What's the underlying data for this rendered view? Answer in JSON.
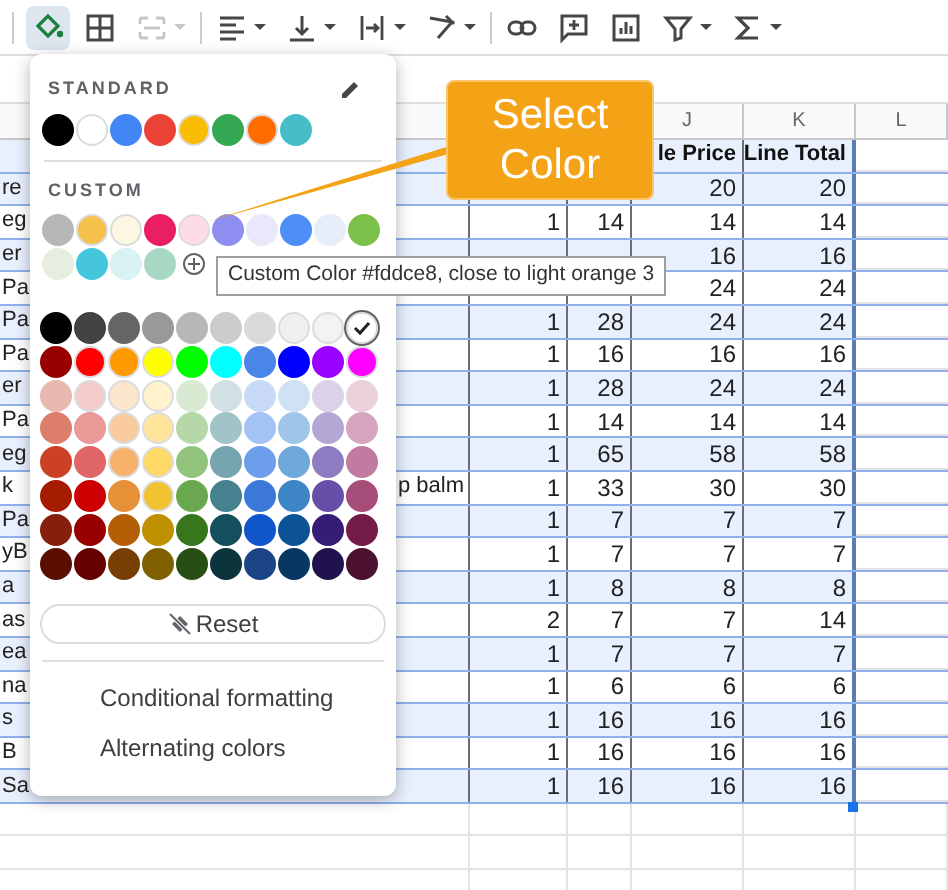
{
  "toolbar": [
    {
      "kind": "fill",
      "active": true,
      "disabled": false,
      "dropdown": false
    },
    {
      "kind": "borders",
      "active": false,
      "disabled": false,
      "dropdown": false
    },
    {
      "kind": "merge",
      "active": false,
      "disabled": true,
      "dropdown": true
    },
    {
      "kind": "align",
      "active": false,
      "disabled": false,
      "dropdown": true
    },
    {
      "kind": "valign",
      "active": false,
      "disabled": false,
      "dropdown": true
    },
    {
      "kind": "wrap",
      "active": false,
      "disabled": false,
      "dropdown": true
    },
    {
      "kind": "rotate",
      "active": false,
      "disabled": false,
      "dropdown": true
    },
    {
      "kind": "link",
      "active": false,
      "disabled": false,
      "dropdown": false
    },
    {
      "kind": "comment",
      "active": false,
      "disabled": false,
      "dropdown": false
    },
    {
      "kind": "chart",
      "active": false,
      "disabled": false,
      "dropdown": false
    },
    {
      "kind": "filter",
      "active": false,
      "disabled": false,
      "dropdown": true
    },
    {
      "kind": "functions",
      "active": false,
      "disabled": false,
      "dropdown": true
    }
  ],
  "sheet": {
    "column_headers": [
      "J",
      "K",
      "L"
    ],
    "header_row": {
      "sale": "le Price",
      "total": "Line Total"
    },
    "rows": [
      {
        "left": "re",
        "sale": "20",
        "total": "20"
      },
      {
        "left": "eg",
        "qty": "1",
        "price": "14",
        "sale": "14",
        "total": "14"
      },
      {
        "left": "er",
        "sale": "16",
        "total": "16"
      },
      {
        "left": "Pa",
        "sale": "24",
        "total": "24"
      },
      {
        "left": "Pa",
        "qty": "1",
        "price": "28",
        "sale": "24",
        "total": "24"
      },
      {
        "left": "Pa",
        "qty": "1",
        "price": "16",
        "sale": "16",
        "total": "16"
      },
      {
        "left": "er",
        "qty": "1",
        "price": "28",
        "sale": "24",
        "total": "24"
      },
      {
        "left": "Pa",
        "qty": "1",
        "price": "14",
        "sale": "14",
        "total": "14"
      },
      {
        "left": "eg",
        "qty": "1",
        "price": "65",
        "sale": "58",
        "total": "58"
      },
      {
        "left": "k",
        "desc": "p balm",
        "qty": "1",
        "price": "33",
        "sale": "30",
        "total": "30"
      },
      {
        "left": "Pa",
        "qty": "1",
        "price": "7",
        "sale": "7",
        "total": "7"
      },
      {
        "left": "yB",
        "qty": "1",
        "price": "7",
        "sale": "7",
        "total": "7"
      },
      {
        "left": "a",
        "qty": "1",
        "price": "8",
        "sale": "8",
        "total": "8"
      },
      {
        "left": "as",
        "qty": "2",
        "price": "7",
        "sale": "7",
        "total": "14"
      },
      {
        "left": "ea",
        "qty": "1",
        "price": "7",
        "sale": "7",
        "total": "7"
      },
      {
        "left": "na",
        "qty": "1",
        "price": "6",
        "sale": "6",
        "total": "6"
      },
      {
        "left": "s",
        "qty": "1",
        "price": "16",
        "sale": "16",
        "total": "16"
      },
      {
        "left": "B",
        "qty": "1",
        "price": "16",
        "sale": "16",
        "total": "16"
      },
      {
        "left": "Sa",
        "qty": "1",
        "price": "16",
        "sale": "16",
        "total": "16"
      }
    ]
  },
  "color_menu": {
    "standard_label": "STANDARD",
    "standard": [
      {
        "color": "#000000"
      },
      {
        "color": "#ffffff"
      },
      {
        "color": "#4285f4"
      },
      {
        "color": "#ea4335"
      },
      {
        "color": "#fbbc04"
      },
      {
        "color": "#34a853"
      },
      {
        "color": "#ff6d01"
      },
      {
        "color": "#46bdc6"
      }
    ],
    "custom_label": "CUSTOM",
    "custom": [
      {
        "color": "#b7b7b7"
      },
      {
        "color": "#f6c14b"
      },
      {
        "color": "#fdf6e3"
      },
      {
        "color": "#e91e63"
      },
      {
        "color": "#fddce8"
      },
      {
        "color": "#8e8ef0"
      },
      {
        "color": "#e8e8fa"
      },
      {
        "color": "#4f8ef7"
      },
      {
        "color": "#e8eef9"
      },
      {
        "color": "#7cc14a"
      },
      {
        "color": "#e6eedf"
      },
      {
        "color": "#46c6dc"
      },
      {
        "color": "#d9f2f4"
      },
      {
        "color": "#a9d8c4"
      }
    ],
    "palette": [
      [
        {
          "color": "#000000",
          "selected": false
        },
        {
          "color": "#434343",
          "selected": false
        },
        {
          "color": "#666666",
          "selected": false
        },
        {
          "color": "#999999",
          "selected": false
        },
        {
          "color": "#b7b7b7",
          "selected": false
        },
        {
          "color": "#cccccc",
          "selected": false
        },
        {
          "color": "#d9d9d9",
          "selected": false
        },
        {
          "color": "#efefef",
          "selected": false
        },
        {
          "color": "#f3f3f3",
          "selected": false
        },
        {
          "color": "#ffffff",
          "selected": true
        }
      ],
      [
        {
          "color": "#980000",
          "selected": false
        },
        {
          "color": "#ff0000",
          "selected": false
        },
        {
          "color": "#ff9900",
          "selected": false
        },
        {
          "color": "#ffff00",
          "selected": false
        },
        {
          "color": "#00ff00",
          "selected": false
        },
        {
          "color": "#00ffff",
          "selected": false
        },
        {
          "color": "#4a86e8",
          "selected": false
        },
        {
          "color": "#0000ff",
          "selected": false
        },
        {
          "color": "#9900ff",
          "selected": false
        },
        {
          "color": "#ff00ff",
          "selected": false
        }
      ],
      [
        {
          "color": "#e6b8af",
          "selected": false
        },
        {
          "color": "#f4cccc",
          "selected": false
        },
        {
          "color": "#fce5cd",
          "selected": false
        },
        {
          "color": "#fff2cc",
          "selected": false
        },
        {
          "color": "#d9ead3",
          "selected": false
        },
        {
          "color": "#d0e0e3",
          "selected": false
        },
        {
          "color": "#c9daf8",
          "selected": false
        },
        {
          "color": "#cfe2f3",
          "selected": false
        },
        {
          "color": "#d9d2e9",
          "selected": false
        },
        {
          "color": "#ead1dc",
          "selected": false
        }
      ],
      [
        {
          "color": "#dd7e6b",
          "selected": false
        },
        {
          "color": "#ea9999",
          "selected": false
        },
        {
          "color": "#f9cb9c",
          "selected": false
        },
        {
          "color": "#ffe599",
          "selected": false
        },
        {
          "color": "#b6d7a8",
          "selected": false
        },
        {
          "color": "#a2c4c9",
          "selected": false
        },
        {
          "color": "#a4c2f4",
          "selected": false
        },
        {
          "color": "#9fc5e8",
          "selected": false
        },
        {
          "color": "#b4a7d6",
          "selected": false
        },
        {
          "color": "#d5a6bd",
          "selected": false
        }
      ],
      [
        {
          "color": "#cc4125",
          "selected": false
        },
        {
          "color": "#e06666",
          "selected": false
        },
        {
          "color": "#f6b26b",
          "selected": false
        },
        {
          "color": "#ffd966",
          "selected": false
        },
        {
          "color": "#93c47d",
          "selected": false
        },
        {
          "color": "#76a5af",
          "selected": false
        },
        {
          "color": "#6d9eeb",
          "selected": false
        },
        {
          "color": "#6fa8dc",
          "selected": false
        },
        {
          "color": "#8e7cc3",
          "selected": false
        },
        {
          "color": "#c27ba0",
          "selected": false
        }
      ],
      [
        {
          "color": "#a61c00",
          "selected": false
        },
        {
          "color": "#cc0000",
          "selected": false
        },
        {
          "color": "#e69138",
          "selected": false
        },
        {
          "color": "#f1c232",
          "selected": false
        },
        {
          "color": "#6aa84f",
          "selected": false
        },
        {
          "color": "#45818e",
          "selected": false
        },
        {
          "color": "#3c78d8",
          "selected": false
        },
        {
          "color": "#3d85c6",
          "selected": false
        },
        {
          "color": "#674ea7",
          "selected": false
        },
        {
          "color": "#a64d79",
          "selected": false
        }
      ],
      [
        {
          "color": "#85200c",
          "selected": false
        },
        {
          "color": "#990000",
          "selected": false
        },
        {
          "color": "#b45f06",
          "selected": false
        },
        {
          "color": "#bf9000",
          "selected": false
        },
        {
          "color": "#38761d",
          "selected": false
        },
        {
          "color": "#134f5c",
          "selected": false
        },
        {
          "color": "#1155cc",
          "selected": false
        },
        {
          "color": "#0b5394",
          "selected": false
        },
        {
          "color": "#351c75",
          "selected": false
        },
        {
          "color": "#741b47",
          "selected": false
        }
      ],
      [
        {
          "color": "#5b0f00",
          "selected": false
        },
        {
          "color": "#660000",
          "selected": false
        },
        {
          "color": "#783f04",
          "selected": false
        },
        {
          "color": "#7f6000",
          "selected": false
        },
        {
          "color": "#274e13",
          "selected": false
        },
        {
          "color": "#0c343d",
          "selected": false
        },
        {
          "color": "#1c4587",
          "selected": false
        },
        {
          "color": "#073763",
          "selected": false
        },
        {
          "color": "#20124d",
          "selected": false
        },
        {
          "color": "#4c1130",
          "selected": false
        }
      ]
    ],
    "reset_label": "Reset",
    "items": [
      "Conditional formatting",
      "Alternating colors"
    ]
  },
  "tooltip": "Custom Color #fddce8, close to light orange 3",
  "callout": "Select Color"
}
